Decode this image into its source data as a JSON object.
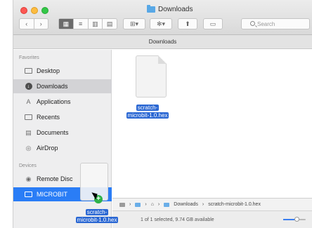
{
  "window": {
    "title": "Downloads"
  },
  "toolbar": {
    "back_glyph": "‹",
    "forward_glyph": "›",
    "view_icons": [
      "▦",
      "≡",
      "▥",
      "▤"
    ],
    "arrange_label": "⊞▾",
    "action_label": "✻▾",
    "share_glyph": "⬆",
    "tags_glyph": "▭",
    "search_placeholder": "Search"
  },
  "pathbar": {
    "label": "Downloads"
  },
  "sidebar": {
    "favorites_header": "Favorites",
    "favorites": [
      {
        "label": "Desktop",
        "icon": "desktop-icon"
      },
      {
        "label": "Downloads",
        "icon": "downloads-icon"
      },
      {
        "label": "Applications",
        "icon": "applications-icon"
      },
      {
        "label": "Recents",
        "icon": "recents-icon"
      },
      {
        "label": "Documents",
        "icon": "documents-icon"
      },
      {
        "label": "AirDrop",
        "icon": "airdrop-icon"
      }
    ],
    "devices_header": "Devices",
    "devices": [
      {
        "label": "Remote Disc",
        "icon": "disc-icon"
      },
      {
        "label": "MICROBIT",
        "icon": "drive-icon"
      }
    ]
  },
  "main": {
    "file": {
      "name_line1": "scratch-",
      "name_line2": "microbit-1.0.hex"
    }
  },
  "bottombar": {
    "segments": [
      "›",
      "›",
      "⌂",
      "›",
      "Downloads",
      "›",
      "scratch-microbit-1.0.hex"
    ]
  },
  "status": {
    "text": "1 of 1 selected, 9.74 GB available"
  },
  "drag": {
    "label_line1": "scratch-",
    "label_line2": "microbit-1.0.hex",
    "badge": "+"
  },
  "colors": {
    "selection": "#2a67d3",
    "device_highlight": "#2a7df6"
  }
}
